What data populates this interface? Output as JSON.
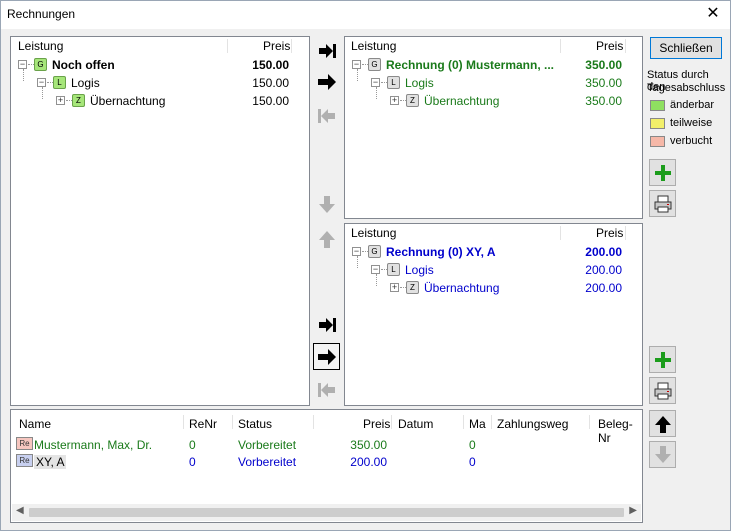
{
  "window": {
    "title": "Rechnungen",
    "close_glyph": "✕"
  },
  "left_panel": {
    "headers": {
      "leistung": "Leistung",
      "preis": "Preis"
    },
    "rows": [
      {
        "label": "Noch offen",
        "badge": "G",
        "price": "150.00"
      },
      {
        "label": "Logis",
        "badge": "L",
        "price": "150.00"
      },
      {
        "label": "Übernachtung",
        "badge": "Z",
        "price": "150.00"
      }
    ]
  },
  "right_top_panel": {
    "headers": {
      "leistung": "Leistung",
      "preis": "Preis"
    },
    "rows": [
      {
        "label": "Rechnung (0) Mustermann, ...",
        "badge": "G",
        "price": "350.00"
      },
      {
        "label": "Logis",
        "badge": "L",
        "price": "350.00"
      },
      {
        "label": "Übernachtung",
        "badge": "Z",
        "price": "350.00"
      }
    ],
    "color": "#1a7a1a"
  },
  "right_bottom_panel": {
    "headers": {
      "leistung": "Leistung",
      "preis": "Preis"
    },
    "rows": [
      {
        "label": "Rechnung (0) XY, A",
        "badge": "G",
        "price": "200.00"
      },
      {
        "label": "Logis",
        "badge": "L",
        "price": "200.00"
      },
      {
        "label": "Übernachtung",
        "badge": "Z",
        "price": "200.00"
      }
    ],
    "color": "#0000cc"
  },
  "side": {
    "close_button": "Schließen",
    "status_title_line1": "Status durch den",
    "status_title_line2": "Tagesabschluss",
    "legend": [
      {
        "label": "änderbar",
        "color": "#8fe060"
      },
      {
        "label": "teilweise",
        "color": "#f2ef6a"
      },
      {
        "label": "verbucht",
        "color": "#f6b8a8"
      }
    ]
  },
  "icons": {
    "move_all_right": "move-all-right-icon",
    "move_right": "move-right-icon",
    "move_all_left": "move-all-left-icon",
    "arrow_down": "arrow-down-icon",
    "arrow_up": "arrow-up-icon",
    "add": "add-icon",
    "print": "print-icon"
  },
  "invoice_table": {
    "columns": [
      "Name",
      "ReNr",
      "Status",
      "Preis",
      "Datum",
      "Ma",
      "Zahlungsweg",
      "Beleg-Nr"
    ],
    "rows": [
      {
        "badge": "Re",
        "name": "Mustermann, Max, Dr.",
        "renr": "0",
        "status": "Vorbereitet",
        "preis": "350.00",
        "datum": "",
        "ma": "0",
        "zahlungsweg": "",
        "beleg": "",
        "color": "#1a7a1a",
        "badge_color": "#f6c6bf"
      },
      {
        "badge": "Re",
        "name": "XY, A",
        "renr": "0",
        "status": "Vorbereitet",
        "preis": "200.00",
        "datum": "",
        "ma": "0",
        "zahlungsweg": "",
        "beleg": "",
        "color": "#0000cc",
        "badge_color": "#c8d0f0"
      }
    ]
  }
}
